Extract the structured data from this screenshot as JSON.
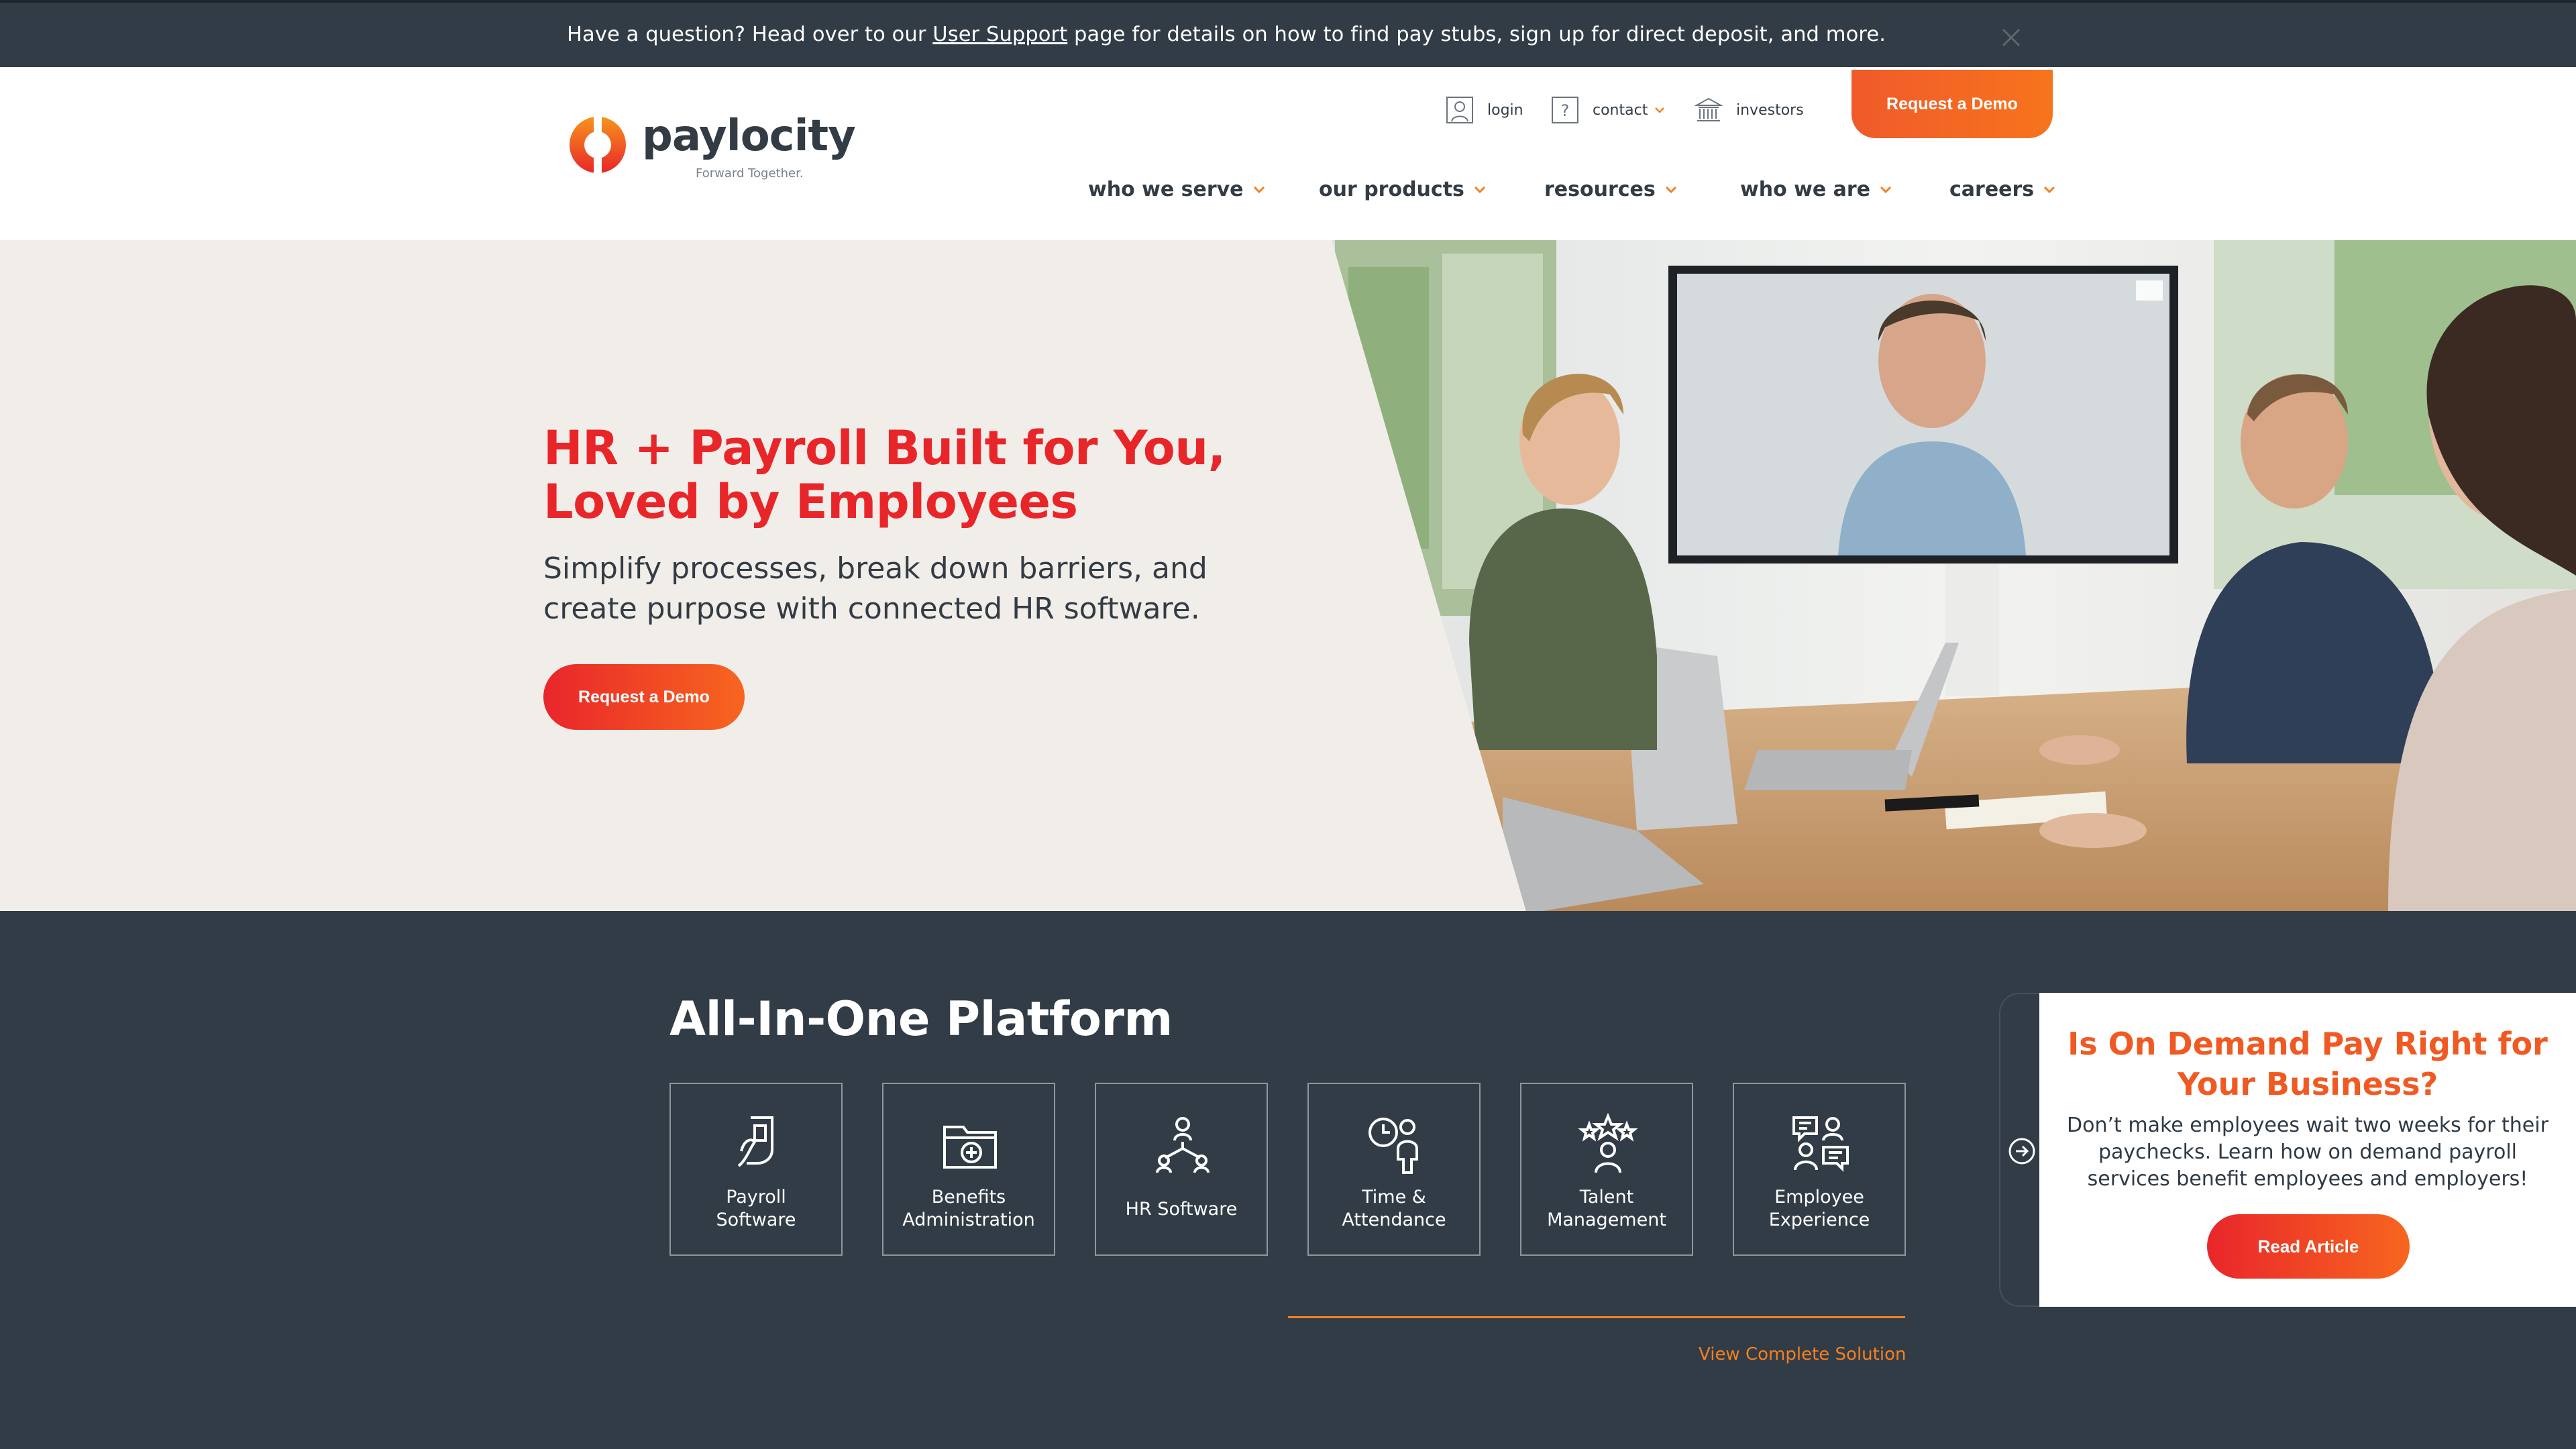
{
  "alert": {
    "text_before": "Have a question? Head over to our ",
    "link": "User Support",
    "text_after": " page for details on how to find pay stubs, sign up for direct deposit, and more."
  },
  "brand": {
    "name": "paylocity",
    "tagline": "Forward Together."
  },
  "utility_nav": {
    "login": "login",
    "contact": "contact",
    "investors": "investors"
  },
  "header_cta": "Request a Demo",
  "main_nav": [
    "who we serve",
    "our products",
    "resources",
    "who we are",
    "careers"
  ],
  "hero": {
    "title_line1": "HR + Payroll Built for You,",
    "title_line2": "Loved by Employees",
    "subtitle_line1": "Simplify processes, break down barriers, and",
    "subtitle_line2": "create purpose with connected HR software.",
    "cta": "Request a Demo"
  },
  "platform": {
    "title": "All-In-One Platform",
    "tiles": [
      {
        "line1": "Payroll",
        "line2": "Software",
        "icon": "payroll-icon"
      },
      {
        "line1": "Benefits",
        "line2": "Administration",
        "icon": "benefits-icon"
      },
      {
        "line1": "HR Software",
        "line2": "",
        "icon": "hr-org-icon"
      },
      {
        "line1": "Time &",
        "line2": "Attendance",
        "icon": "time-icon"
      },
      {
        "line1": "Talent",
        "line2": "Management",
        "icon": "talent-icon"
      },
      {
        "line1": "Employee",
        "line2": "Experience",
        "icon": "employee-chat-icon"
      }
    ],
    "link": "View Complete Solution"
  },
  "promo": {
    "title": "Is On Demand Pay Right for Your Business?",
    "text": "Don’t make employees wait two weeks for their paychecks. Learn how on demand payroll services benefit employees and employers!",
    "cta": "Read Article"
  },
  "colors": {
    "accent": "#f05a22",
    "red": "#e8262a",
    "dark": "#323c46",
    "orange": "#f4801f"
  }
}
